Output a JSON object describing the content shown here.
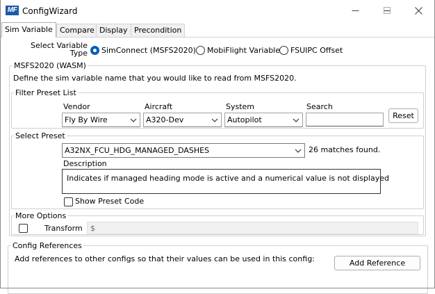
{
  "window": {
    "title": "ConfigWizard",
    "logo_text": "MF"
  },
  "tabs": [
    {
      "label": "Sim Variable",
      "active": true
    },
    {
      "label": "Compare",
      "active": false
    },
    {
      "label": "Display",
      "active": false
    },
    {
      "label": "Precondition",
      "active": false
    }
  ],
  "variable_type": {
    "label": "Select Variable Type",
    "options": [
      {
        "label": "SimConnect (MSFS2020)",
        "selected": true
      },
      {
        "label": "MobiFlight Variable",
        "selected": false
      },
      {
        "label": "FSUIPC Offset",
        "selected": false
      }
    ]
  },
  "wasm_group": {
    "title": "MSFS2020 (WASM)",
    "description": "Define the sim variable name that you would like to read from MSFS2020."
  },
  "filter_group": {
    "title": "Filter Preset List",
    "vendor": {
      "label": "Vendor",
      "value": "Fly By Wire"
    },
    "aircraft": {
      "label": "Aircraft",
      "value": "A320-Dev"
    },
    "system": {
      "label": "System",
      "value": "Autopilot"
    },
    "search": {
      "label": "Search",
      "value": ""
    },
    "reset_label": "Reset"
  },
  "preset_group": {
    "title": "Select Preset",
    "preset_value": "A32NX_FCU_HDG_MANAGED_DASHES",
    "matches_text": "26 matches found.",
    "description_label": "Description",
    "description_text": "Indicates if managed heading mode is active and a numerical value is not displayed",
    "show_code_label": "Show Preset Code",
    "show_code_checked": false
  },
  "more_options": {
    "title": "More Options",
    "transform_label": "Transform",
    "transform_checked": false,
    "transform_value": "$"
  },
  "config_refs": {
    "title": "Config References",
    "description": "Add references to other configs so that their values can be used in this config:",
    "add_button_label": "Add Reference"
  },
  "colors": {
    "accent": "#005fb8",
    "logo_bg": "#1c5aa6",
    "group_border": "#d0d0d0"
  },
  "icons": {
    "minimize": "minimize-icon",
    "maximize": "maximize-icon",
    "close": "close-icon",
    "dropdown": "chevron-down-icon"
  }
}
